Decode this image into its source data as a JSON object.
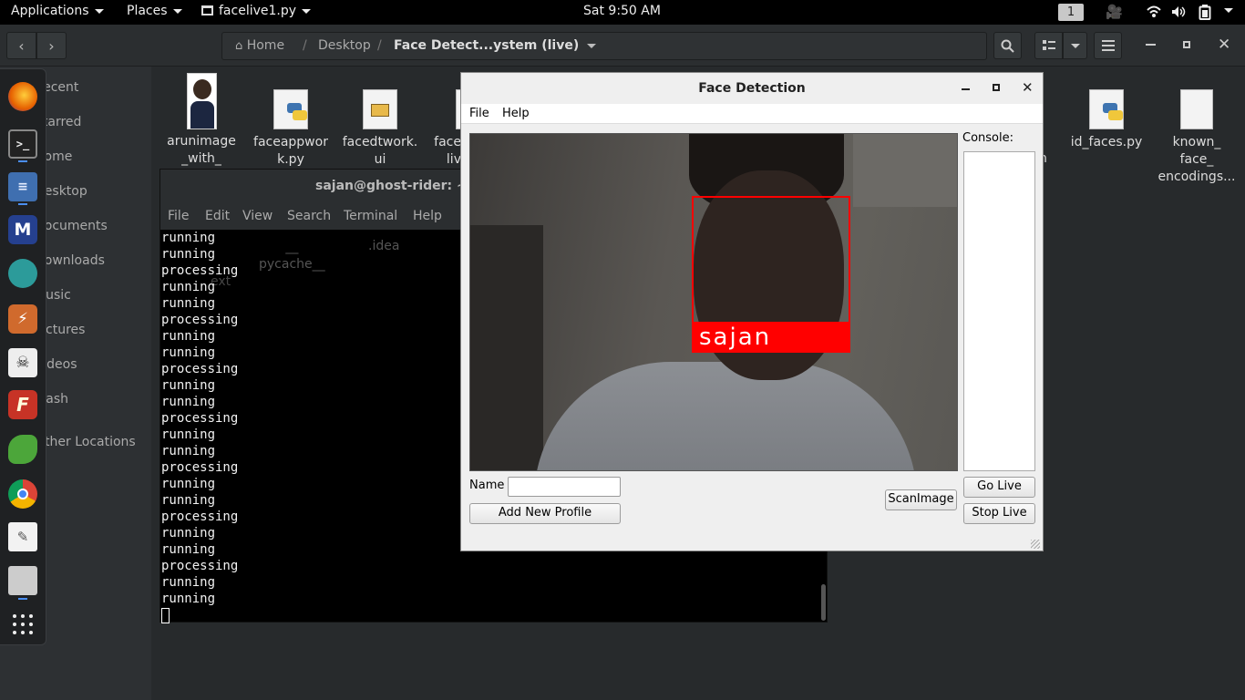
{
  "topbar": {
    "applications": "Applications",
    "places": "Places",
    "app_name": "facelive1.py",
    "clock": "Sat  9:50 AM",
    "workspace": "1"
  },
  "files_window": {
    "path": {
      "home": "Home",
      "desktop": "Desktop",
      "current": "Face Detect...ystem (live)"
    },
    "sidebar": [
      "Recent",
      "Starred",
      "Home",
      "Desktop",
      "Documents",
      "Downloads",
      "Music",
      "Pictures",
      "Videos",
      "Trash",
      "Other Locations"
    ],
    "icons": [
      {
        "name": "arunimage\n_with_",
        "type": "image"
      },
      {
        "name": "faceappwor\nk.py",
        "type": "python"
      },
      {
        "name": "facedtwork.\nui",
        "type": "ui"
      },
      {
        "name": "face\nliv",
        "type": "doc"
      },
      {
        "name": "id_faces.py",
        "type": "python"
      },
      {
        "name": "known_\nface_\nencodings...",
        "type": "doc"
      }
    ],
    "partial_labels": [
      "__\npycache__",
      ".idea",
      "ext",
      "n"
    ]
  },
  "terminal": {
    "title": "sajan@ghost-rider: ~/De",
    "menu": [
      "File",
      "Edit",
      "View",
      "Search",
      "Terminal",
      "Help"
    ],
    "lines": [
      "running",
      "running",
      "processing",
      "running",
      "running",
      "processing",
      "running",
      "running",
      "processing",
      "running",
      "running",
      "processing",
      "running",
      "running",
      "processing",
      "running",
      "running",
      "processing",
      "running",
      "running",
      "processing",
      "running",
      "running"
    ]
  },
  "face_window": {
    "title": "Face Detection",
    "menu": [
      "File",
      "Help"
    ],
    "detected_name": "sajan",
    "console_label": "Console:",
    "name_label": "Name",
    "name_value": "",
    "add_profile": "Add New Profile",
    "scan_image": "ScanImage",
    "go_live": "Go Live",
    "stop_live": "Stop Live"
  },
  "colors": {
    "accent": "#4a8ef0",
    "face_box": "#ff0000"
  }
}
